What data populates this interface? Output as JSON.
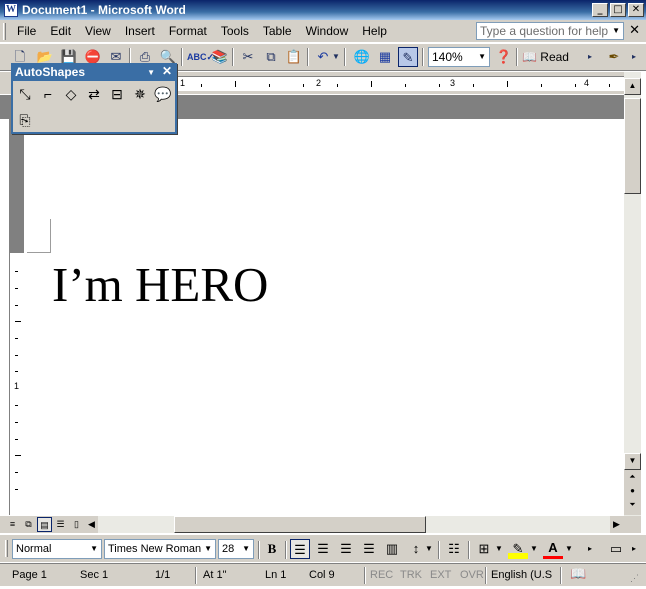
{
  "window": {
    "title": "Document1 - Microsoft Word",
    "app_icon": "W"
  },
  "caption_buttons": {
    "minimize": "_",
    "maximize": "□",
    "close": "✕"
  },
  "menu": {
    "items": [
      "File",
      "Edit",
      "View",
      "Insert",
      "Format",
      "Tools",
      "Table",
      "Window",
      "Help"
    ],
    "ask_placeholder": "Type a question for help",
    "close_doc": "✕"
  },
  "toolbar": {
    "zoom": "140%",
    "read_label": "Read"
  },
  "ruler": {
    "numbers": [
      "1",
      "2",
      "3",
      "4"
    ]
  },
  "vruler_number": "1",
  "autoshapes": {
    "title": "AutoShapes"
  },
  "document": {
    "text": "I’m HERO"
  },
  "format": {
    "style": "Normal",
    "font": "Times New Roman",
    "size": "28",
    "bold_label": "B",
    "font_color_label": "A"
  },
  "status": {
    "page": "Page  1",
    "sec": "Sec  1",
    "pages": "1/1",
    "at": "At  1\"",
    "ln": "Ln  1",
    "col": "Col  9",
    "rec": "REC",
    "trk": "TRK",
    "ext": "EXT",
    "ovr": "OVR",
    "language": "English (U.S"
  },
  "colors": {
    "title_bar": "#0a246a",
    "chrome": "#d4d0c8",
    "highlight": "#ffff00",
    "font_color": "#ff0000"
  }
}
